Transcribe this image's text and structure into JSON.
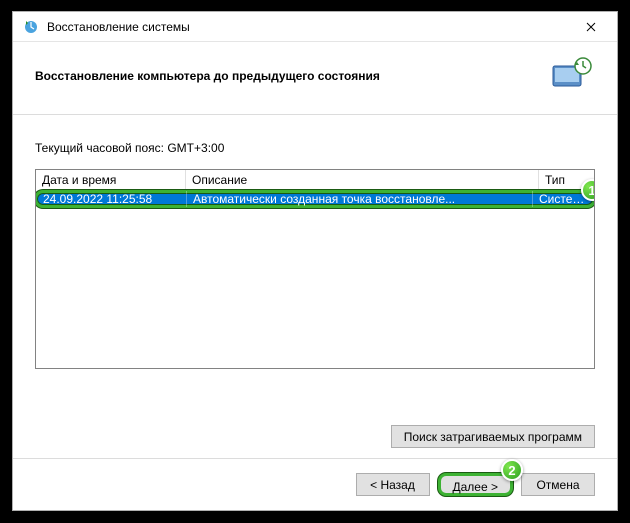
{
  "window": {
    "title": "Восстановление системы"
  },
  "header": {
    "subtitle": "Восстановление компьютера до предыдущего состояния"
  },
  "content": {
    "timezone_label": "Текущий часовой пояс: GMT+3:00",
    "columns": {
      "date": "Дата и время",
      "desc": "Описание",
      "type": "Тип"
    },
    "rows": [
      {
        "date": "24.09.2022 11:25:58",
        "desc": "Автоматически созданная точка восстановле...",
        "type": "Система"
      }
    ],
    "affected_btn": "Поиск затрагиваемых программ"
  },
  "footer": {
    "back": "< Назад",
    "next": "Далее >",
    "cancel": "Отмена"
  },
  "annotations": {
    "badge1": "1",
    "badge2": "2"
  }
}
